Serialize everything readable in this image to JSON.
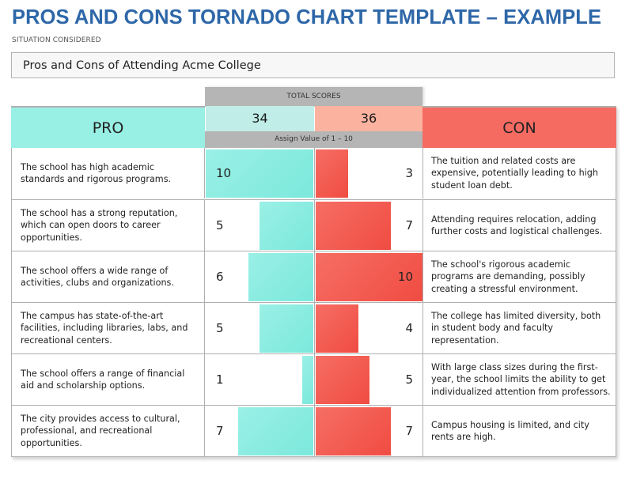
{
  "title": "PROS AND CONS TORNADO CHART TEMPLATE – EXAMPLE",
  "situation": {
    "label": "SITUATION CONSIDERED",
    "value": "Pros and Cons of Attending Acme College"
  },
  "colors": {
    "title": "#2e67a8",
    "pro": "#98efe4",
    "con": "#f56b62",
    "pro_total": "#c0ede7",
    "con_total": "#fbb29f",
    "header_gray": "#b5b5b5"
  },
  "headers": {
    "pro": "PRO",
    "con": "CON",
    "total_scores": "TOTAL SCORES",
    "assign": "Assign Value of 1 – 10"
  },
  "totals": {
    "pro": "34",
    "con": "36"
  },
  "chart_data": {
    "type": "bar",
    "orientation": "horizontal-tornado",
    "title": "Pros and Cons of Attending Acme College",
    "value_range": [
      0,
      10
    ],
    "series": [
      {
        "name": "PRO",
        "total": 34,
        "values": [
          10,
          5,
          6,
          5,
          1,
          7
        ]
      },
      {
        "name": "CON",
        "total": 36,
        "values": [
          3,
          7,
          10,
          4,
          5,
          7
        ]
      }
    ],
    "rows": [
      {
        "pro": "The school has high academic standards and rigorous programs.",
        "pro_value": 10,
        "con": "The tuition and related costs are expensive, potentially leading to high student loan debt.",
        "con_value": 3
      },
      {
        "pro": "The school has a strong reputation, which can open doors to career opportunities.",
        "pro_value": 5,
        "con": "Attending requires relocation, adding further costs and logistical challenges.",
        "con_value": 7
      },
      {
        "pro": "The school offers a wide range of activities, clubs and organizations.",
        "pro_value": 6,
        "con": "The school's rigorous academic programs are demanding, possibly creating a stressful environment.",
        "con_value": 10
      },
      {
        "pro": "The campus has state-of-the-art facilities, including libraries, labs, and recreational centers.",
        "pro_value": 5,
        "con": "The college has limited diversity, both in student body and faculty representation.",
        "con_value": 4
      },
      {
        "pro": "The school offers a range of financial aid and scholarship options.",
        "pro_value": 1,
        "con": "With large class sizes during the first-year, the school limits the ability to get individualized attention from professors.",
        "con_value": 5
      },
      {
        "pro": "The city provides access to cultural, professional, and recreational opportunities.",
        "pro_value": 7,
        "con": "Campus housing is limited, and city rents are high.",
        "con_value": 7
      }
    ]
  }
}
